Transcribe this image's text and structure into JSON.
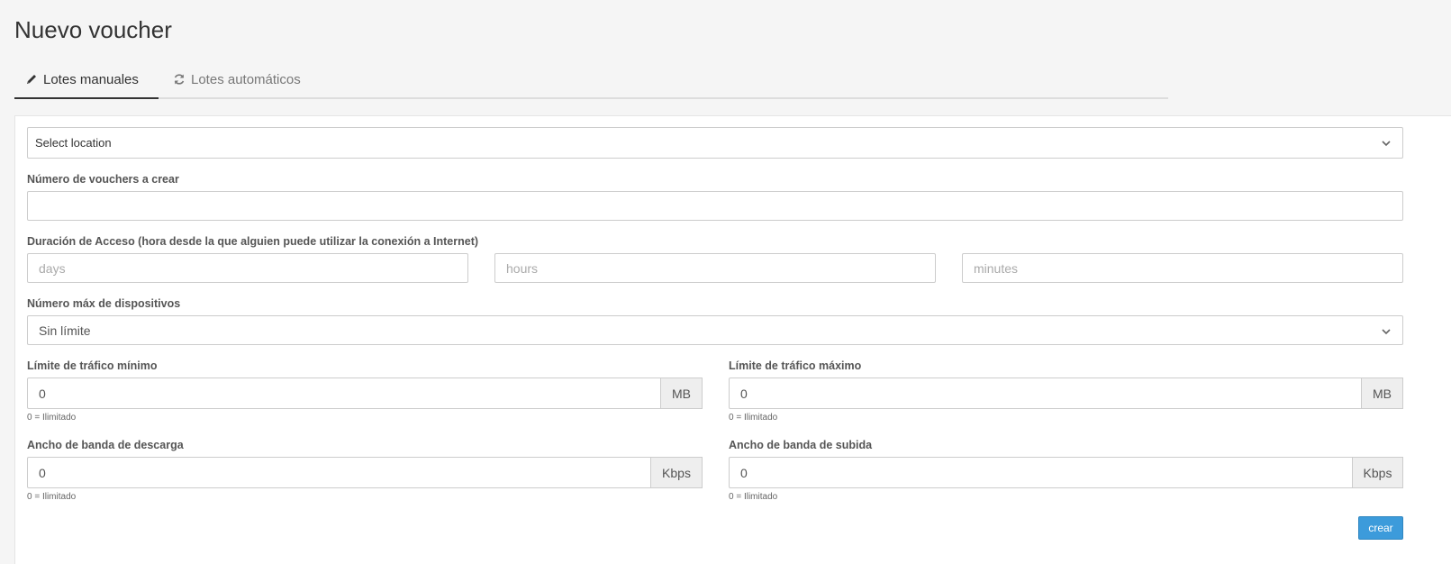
{
  "page": {
    "title": "Nuevo voucher"
  },
  "tabs": [
    {
      "label": "Lotes manuales",
      "icon": "pencil-icon",
      "active": true
    },
    {
      "label": "Lotes automáticos",
      "icon": "refresh-icon",
      "active": false
    }
  ],
  "form": {
    "location": {
      "value": "Select location"
    },
    "vouchers_count": {
      "label": "Número de vouchers a crear",
      "value": ""
    },
    "duration": {
      "label": "Duración de Acceso (hora desde la que alguien puede utilizar la conexión a Internet)",
      "days_placeholder": "days",
      "hours_placeholder": "hours",
      "minutes_placeholder": "minutes"
    },
    "max_devices": {
      "label": "Número máx de dispositivos",
      "value": "Sin límite"
    },
    "traffic_min": {
      "label": "Límite de tráfico mínimo",
      "value": "0",
      "unit": "MB",
      "help": "0 = Ilimitado"
    },
    "traffic_max": {
      "label": "Límite de tráfico máximo",
      "value": "0",
      "unit": "MB",
      "help": "0 = Ilimitado"
    },
    "download_bw": {
      "label": "Ancho de banda de descarga",
      "value": "0",
      "unit": "Kbps",
      "help": "0 = Ilimitado"
    },
    "upload_bw": {
      "label": "Ancho de banda de subida",
      "value": "0",
      "unit": "Kbps",
      "help": "0 = Ilimitado"
    },
    "create_button": "crear"
  },
  "colors": {
    "primary": "#3c9bdb",
    "background": "#f5f5f5",
    "tab_active": "#333333"
  }
}
